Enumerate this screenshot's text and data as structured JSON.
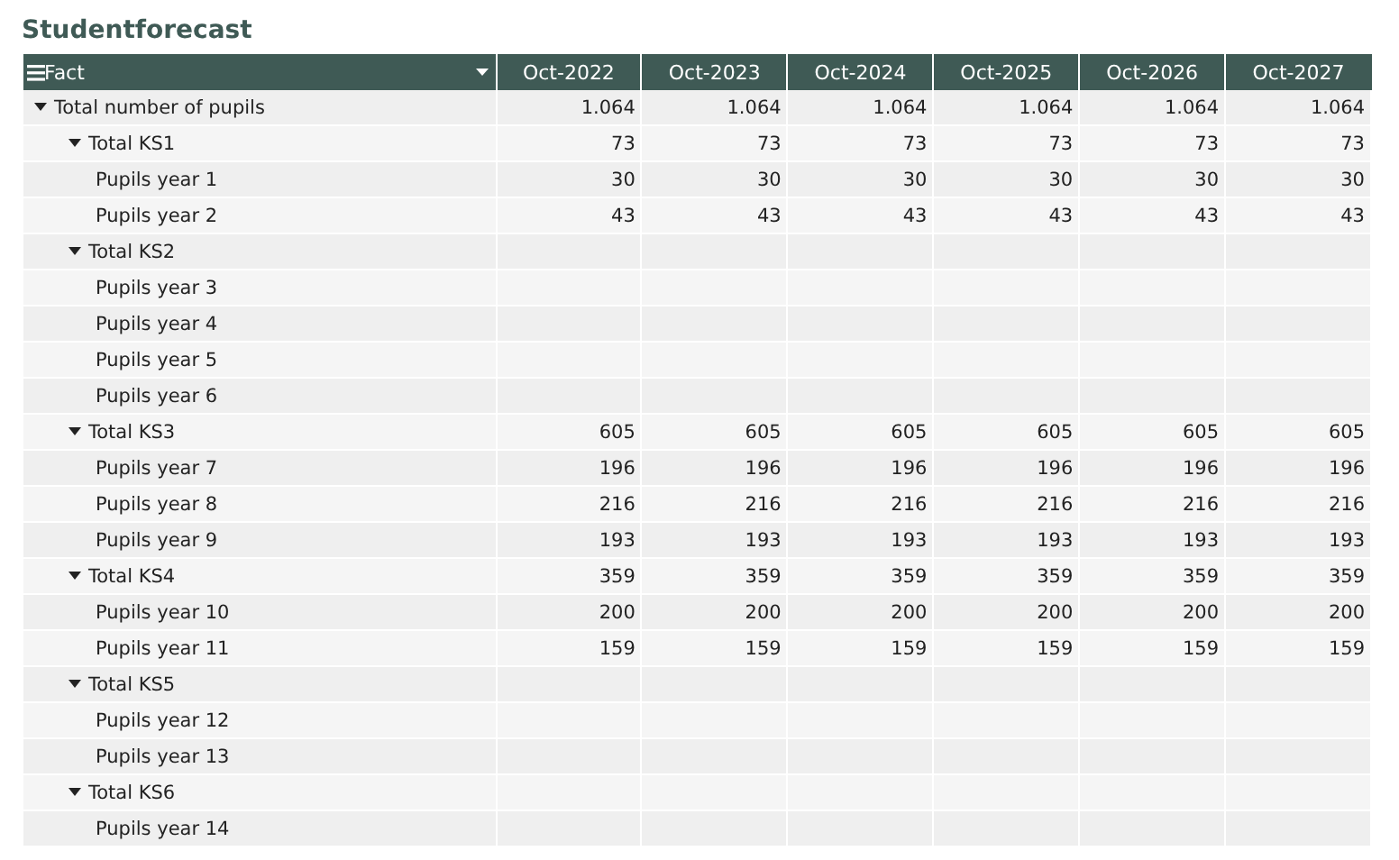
{
  "title": "Studentforecast",
  "table": {
    "fact_header": "Fact",
    "columns": [
      "Oct-2022",
      "Oct-2023",
      "Oct-2024",
      "Oct-2025",
      "Oct-2026",
      "Oct-2027"
    ],
    "rows": [
      {
        "label": "Total number of pupils",
        "expanded": true,
        "values": [
          "1.064",
          "1.064",
          "1.064",
          "1.064",
          "1.064",
          "1.064"
        ],
        "children": [
          {
            "label": "Total KS1",
            "expanded": true,
            "values": [
              "73",
              "73",
              "73",
              "73",
              "73",
              "73"
            ],
            "children": [
              {
                "label": "Pupils year 1",
                "values": [
                  "30",
                  "30",
                  "30",
                  "30",
                  "30",
                  "30"
                ]
              },
              {
                "label": "Pupils year 2",
                "values": [
                  "43",
                  "43",
                  "43",
                  "43",
                  "43",
                  "43"
                ]
              }
            ]
          },
          {
            "label": "Total KS2",
            "expanded": true,
            "children": [
              {
                "label": "Pupils year 3"
              },
              {
                "label": "Pupils year 4"
              },
              {
                "label": "Pupils year 5"
              },
              {
                "label": "Pupils year 6"
              }
            ]
          },
          {
            "label": "Total KS3",
            "expanded": true,
            "values": [
              "605",
              "605",
              "605",
              "605",
              "605",
              "605"
            ],
            "children": [
              {
                "label": "Pupils year 7",
                "values": [
                  "196",
                  "196",
                  "196",
                  "196",
                  "196",
                  "196"
                ]
              },
              {
                "label": "Pupils year 8",
                "values": [
                  "216",
                  "216",
                  "216",
                  "216",
                  "216",
                  "216"
                ]
              },
              {
                "label": "Pupils year 9",
                "values": [
                  "193",
                  "193",
                  "193",
                  "193",
                  "193",
                  "193"
                ]
              }
            ]
          },
          {
            "label": "Total KS4",
            "expanded": true,
            "values": [
              "359",
              "359",
              "359",
              "359",
              "359",
              "359"
            ],
            "children": [
              {
                "label": "Pupils year 10",
                "values": [
                  "200",
                  "200",
                  "200",
                  "200",
                  "200",
                  "200"
                ]
              },
              {
                "label": "Pupils year 11",
                "values": [
                  "159",
                  "159",
                  "159",
                  "159",
                  "159",
                  "159"
                ]
              }
            ]
          },
          {
            "label": "Total KS5",
            "expanded": true,
            "children": [
              {
                "label": "Pupils year 12"
              },
              {
                "label": "Pupils year 13"
              }
            ]
          },
          {
            "label": "Total KS6",
            "expanded": true,
            "children": [
              {
                "label": "Pupils year 14"
              }
            ]
          }
        ]
      }
    ]
  }
}
